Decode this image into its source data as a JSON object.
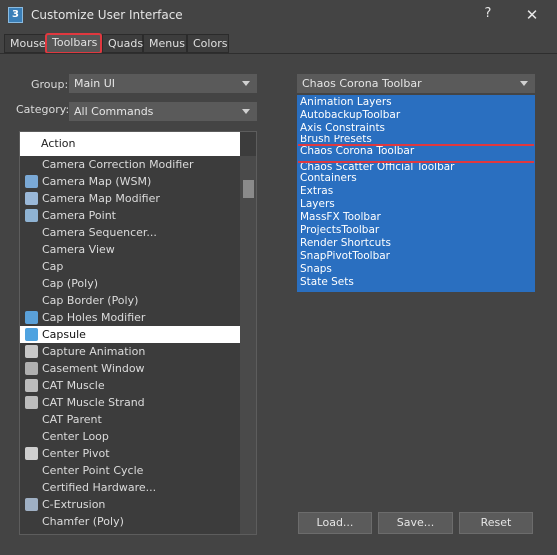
{
  "window": {
    "title": "Customize User Interface",
    "icon_label": "3",
    "help_label": "?",
    "close_label": "✕"
  },
  "tabs": [
    {
      "label": "Mouse"
    },
    {
      "label": "Toolbars",
      "active": true
    },
    {
      "label": "Quads"
    },
    {
      "label": "Menus"
    },
    {
      "label": "Colors"
    }
  ],
  "group": {
    "label": "Group:",
    "value": "Main UI"
  },
  "category": {
    "label": "Category:",
    "value": "All Commands"
  },
  "action_list": {
    "header": "Action",
    "rows": [
      {
        "label": "Camera Correction Modifier",
        "icon": "none"
      },
      {
        "label": "Camera Map (WSM)",
        "icon": "camera-map-wsm-icon"
      },
      {
        "label": "Camera Map Modifier",
        "icon": "camera-map-modifier-icon"
      },
      {
        "label": "Camera Point",
        "icon": "camera-point-icon"
      },
      {
        "label": "Camera Sequencer...",
        "icon": "none"
      },
      {
        "label": "Camera View",
        "icon": "none"
      },
      {
        "label": "Cap",
        "icon": "none"
      },
      {
        "label": "Cap (Poly)",
        "icon": "none"
      },
      {
        "label": "Cap Border (Poly)",
        "icon": "none"
      },
      {
        "label": "Cap Holes Modifier",
        "icon": "cap-holes-modifier-icon"
      },
      {
        "label": "Capsule",
        "icon": "capsule-icon",
        "selected": true
      },
      {
        "label": "Capture Animation",
        "icon": "capture-animation-icon"
      },
      {
        "label": "Casement Window",
        "icon": "casement-window-icon"
      },
      {
        "label": "CAT Muscle",
        "icon": "cat-muscle-icon"
      },
      {
        "label": "CAT Muscle Strand",
        "icon": "cat-muscle-strand-icon"
      },
      {
        "label": "CAT Parent",
        "icon": "none"
      },
      {
        "label": "Center Loop",
        "icon": "none"
      },
      {
        "label": "Center Pivot",
        "icon": "center-pivot-icon"
      },
      {
        "label": "Center Point Cycle",
        "icon": "none"
      },
      {
        "label": "Certified Hardware...",
        "icon": "none"
      },
      {
        "label": "C-Extrusion",
        "icon": "c-extrusion-icon"
      },
      {
        "label": "Chamfer (Poly)",
        "icon": "none"
      }
    ]
  },
  "toolbar_dropdown": {
    "value": "Chaos Corona Toolbar",
    "options": [
      {
        "label": "Animation Layers"
      },
      {
        "label": "AutobackupToolbar"
      },
      {
        "label": "Axis Constraints"
      },
      {
        "label": "Brush Presets",
        "partial": true
      },
      {
        "label": "Chaos Corona Toolbar",
        "selected": true
      },
      {
        "label": "Chaos Scatter Official Toolbar",
        "partial": true
      },
      {
        "label": "Containers"
      },
      {
        "label": "Extras"
      },
      {
        "label": "Layers"
      },
      {
        "label": "MassFX Toolbar"
      },
      {
        "label": "ProjectsToolbar"
      },
      {
        "label": "Render Shortcuts"
      },
      {
        "label": "SnapPivotToolbar"
      },
      {
        "label": "Snaps"
      },
      {
        "label": "State Sets"
      }
    ]
  },
  "buttons": {
    "load": "Load...",
    "save": "Save...",
    "reset": "Reset"
  },
  "colors": {
    "accent_highlight": "#e0383f",
    "list_selection": "#2a6fc0",
    "background": "#444444"
  }
}
